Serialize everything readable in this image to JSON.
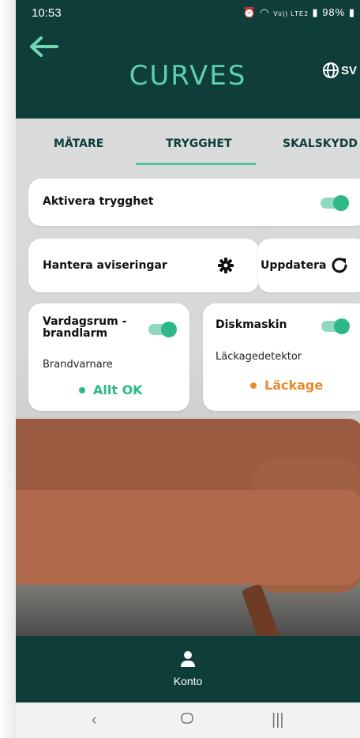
{
  "statusbar": {
    "time": "10:53",
    "battery": "98%",
    "signal_text": "Vo)) LTE2"
  },
  "header": {
    "back_icon": "arrow-left-icon",
    "logo": "CURVES",
    "language": "SV",
    "language_icon": "globe-icon"
  },
  "tabs": [
    {
      "label": "MÄTARE",
      "active": false
    },
    {
      "label": "TRYGGHET",
      "active": true
    },
    {
      "label": "SKALSKYDD",
      "active": false
    }
  ],
  "activate": {
    "label": "Aktivera trygghet",
    "enabled": true
  },
  "notifications": {
    "label": "Hantera aviseringar",
    "icon": "gear-icon"
  },
  "refresh": {
    "label": "Uppdatera",
    "icon": "refresh-icon"
  },
  "devices": [
    {
      "name": "Vardagsrum - brandlarm",
      "type": "Brandvarnare",
      "status": "Allt OK",
      "status_color": "#2db886",
      "enabled": true
    },
    {
      "name": "Diskmaskin",
      "type": "Läckagedetektor",
      "status": "Läckage",
      "status_color": "#e8892b",
      "enabled": true
    }
  ],
  "bottom_nav": {
    "label": "Konto",
    "icon": "user-icon"
  },
  "colors": {
    "primary": "#0f3d3a",
    "accent": "#4fc3a1",
    "ok": "#2db886",
    "warning": "#e8892b"
  }
}
